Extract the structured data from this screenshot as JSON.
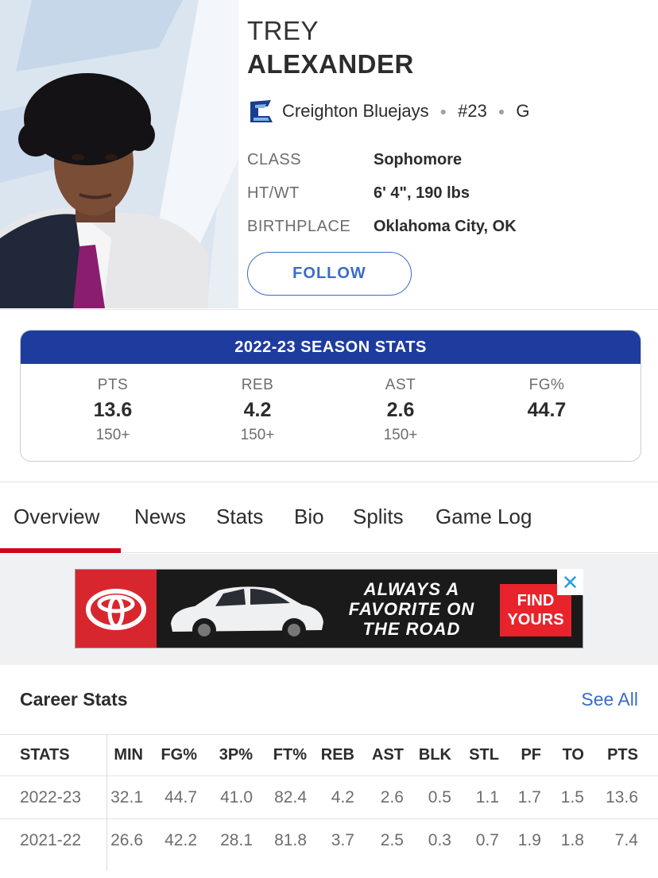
{
  "player": {
    "first_name": "TREY",
    "last_name": "ALEXANDER",
    "team": "Creighton Bluejays",
    "number": "#23",
    "position": "G",
    "bio": [
      {
        "label": "CLASS",
        "value": "Sophomore"
      },
      {
        "label": "HT/WT",
        "value": "6' 4\", 190 lbs"
      },
      {
        "label": "BIRTHPLACE",
        "value": "Oklahoma City, OK"
      }
    ],
    "follow_label": "FOLLOW"
  },
  "season": {
    "title": "2022-23 SEASON STATS",
    "stats": [
      {
        "label": "PTS",
        "value": "13.6",
        "rank": "150+"
      },
      {
        "label": "REB",
        "value": "4.2",
        "rank": "150+"
      },
      {
        "label": "AST",
        "value": "2.6",
        "rank": "150+"
      },
      {
        "label": "FG%",
        "value": "44.7",
        "rank": ""
      }
    ]
  },
  "tabs": [
    "Overview",
    "News",
    "Stats",
    "Bio",
    "Splits",
    "Game Log"
  ],
  "ad": {
    "headline": "ALWAYS A FAVORITE ON THE ROAD",
    "cta": "FIND YOURS",
    "close_symbol": "✕"
  },
  "career": {
    "title": "Career Stats",
    "see_all": "See All",
    "headers": [
      "STATS",
      "MIN",
      "FG%",
      "3P%",
      "FT%",
      "REB",
      "AST",
      "BLK",
      "STL",
      "PF",
      "TO",
      "PTS"
    ],
    "rows": [
      [
        "2022-23",
        "32.1",
        "44.7",
        "41.0",
        "82.4",
        "4.2",
        "2.6",
        "0.5",
        "1.1",
        "1.7",
        "1.5",
        "13.6"
      ],
      [
        "2021-22",
        "26.6",
        "42.2",
        "28.1",
        "81.8",
        "3.7",
        "2.5",
        "0.3",
        "0.7",
        "1.9",
        "1.8",
        "7.4"
      ]
    ]
  },
  "colors": {
    "accent_blue": "#3a6bc7",
    "season_header": "#1e3c9e",
    "tab_active": "#d0021b",
    "ad_red": "#e8232c"
  }
}
